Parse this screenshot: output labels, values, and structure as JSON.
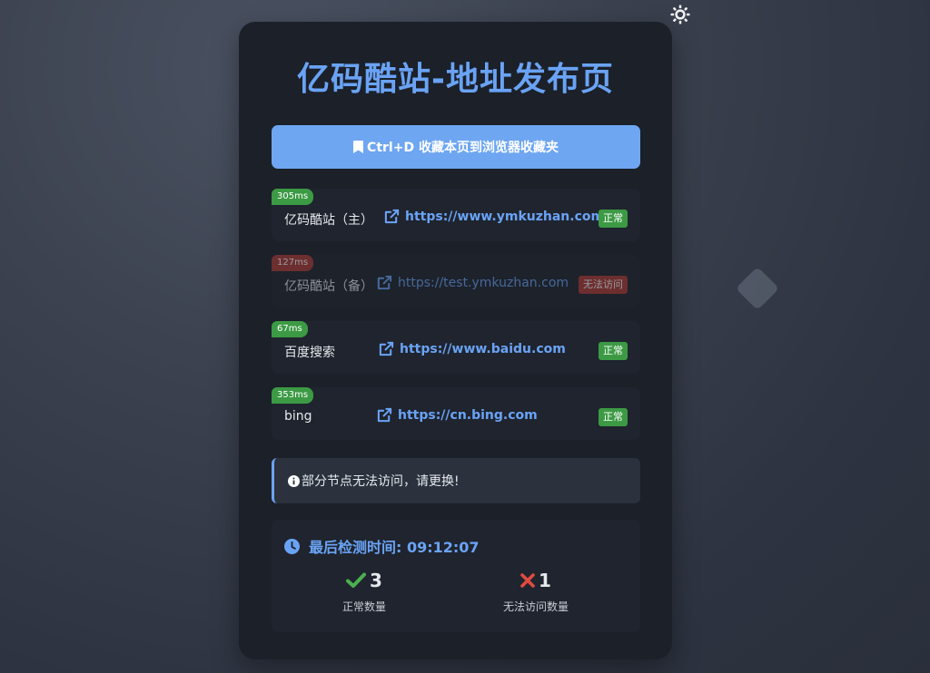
{
  "title": "亿码酷站-地址发布页",
  "bookmark_button": {
    "label": "Ctrl+D 收藏本页到浏览器收藏夹",
    "icon": "bookmark-icon"
  },
  "theme_toggle": {
    "icon": "sun-icon"
  },
  "colors": {
    "accent": "#6aa3f5",
    "ok": "#3c9a44",
    "bad": "#b03a35",
    "card": "#1b2029"
  },
  "links": [
    {
      "latency": "305ms",
      "name": "亿码酷站（主）",
      "url": "https://www.ymkuzhan.com",
      "status": "正常",
      "state": "ok"
    },
    {
      "latency": "127ms",
      "name": "亿码酷站（备）",
      "url": "https://test.ymkuzhan.com",
      "status": "无法访问",
      "state": "bad"
    },
    {
      "latency": "67ms",
      "name": "百度搜索",
      "url": "https://www.baidu.com",
      "status": "正常",
      "state": "ok"
    },
    {
      "latency": "353ms",
      "name": "bing",
      "url": "https://cn.bing.com",
      "status": "正常",
      "state": "ok"
    }
  ],
  "notice": {
    "text": "部分节点无法访问，请更换!",
    "icon": "info-icon"
  },
  "stats": {
    "check_time": "最后检测时间: 09:12:07",
    "ok_count": "3",
    "ok_label": "正常数量",
    "bad_count": "1",
    "bad_label": "无法访问数量"
  }
}
